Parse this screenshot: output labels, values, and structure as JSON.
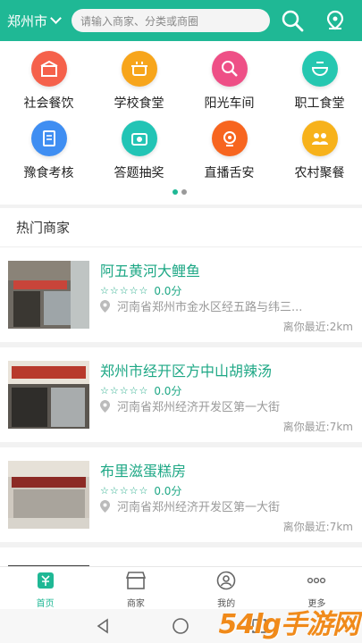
{
  "header": {
    "city": "郑州市",
    "search_placeholder": "请输入商家、分类或商圈",
    "accent": "#1fb895"
  },
  "categories": [
    {
      "label": "社会餐饮",
      "icon": "restaurant-icon",
      "color": "#f5614b"
    },
    {
      "label": "学校食堂",
      "icon": "pot-icon",
      "color": "#f7a51b"
    },
    {
      "label": "阳光车间",
      "icon": "kitchen-search-icon",
      "color": "#ee4f86"
    },
    {
      "label": "职工食堂",
      "icon": "bowl-icon",
      "color": "#25c7b0"
    },
    {
      "label": "豫食考核",
      "icon": "clipboard-icon",
      "color": "#3f8ef2"
    },
    {
      "label": "答题抽奖",
      "icon": "camera-icon",
      "color": "#22c4b5"
    },
    {
      "label": "直播舌安",
      "icon": "live-icon",
      "color": "#f7651f"
    },
    {
      "label": "农村聚餐",
      "icon": "people-icon",
      "color": "#f7b21b"
    }
  ],
  "pager": {
    "pages": 2,
    "current": 1
  },
  "hot": {
    "title": "热门商家",
    "shops": [
      {
        "name": "阿五黄河大鲤鱼",
        "score": "0.0分",
        "address": "河南省郑州市金水区经五路与纬三...",
        "distance": "离你最近:2km",
        "stars": "☆☆☆☆☆"
      },
      {
        "name": "郑州市经开区方中山胡辣汤",
        "score": "0.0分",
        "address": "河南省郑州经济开发区第一大街",
        "distance": "离你最近:7km",
        "stars": "☆☆☆☆☆"
      },
      {
        "name": "布里滋蛋糕房",
        "score": "0.0分",
        "address": "河南省郑州经济开发区第一大街",
        "distance": "离你最近:7km",
        "stars": "☆☆☆☆☆"
      }
    ]
  },
  "bottom_nav": [
    {
      "label": "首页",
      "icon": "home-icon"
    },
    {
      "label": "商家",
      "icon": "store-icon"
    },
    {
      "label": "我的",
      "icon": "profile-icon"
    },
    {
      "label": "更多",
      "icon": "more-icon"
    }
  ],
  "watermark": "54lg手游网"
}
